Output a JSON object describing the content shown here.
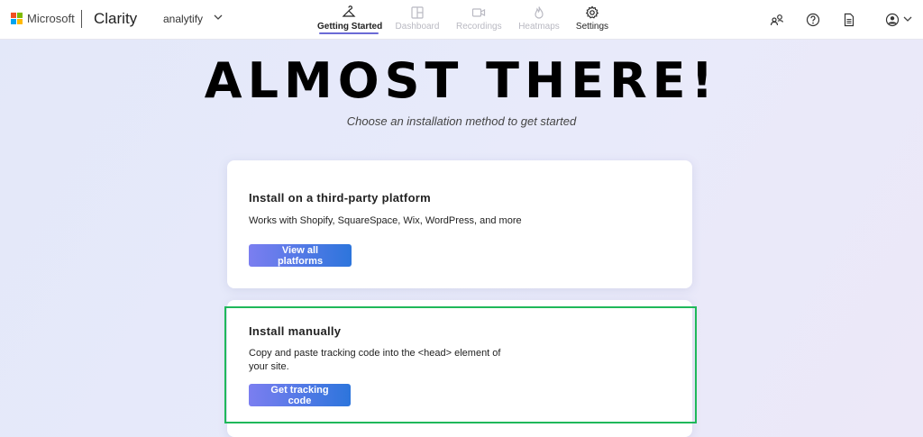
{
  "header": {
    "ms_text": "Microsoft",
    "brand": "Clarity",
    "project": "analytify",
    "logo_colors": [
      "#f25022",
      "#7fba00",
      "#00a4ef",
      "#ffb900"
    ]
  },
  "nav": {
    "getting_started": "Getting Started",
    "dashboard": "Dashboard",
    "recordings": "Recordings",
    "heatmaps": "Heatmaps",
    "settings": "Settings"
  },
  "icons": {
    "getting_started": "hanger-icon",
    "dashboard": "grid-icon",
    "recordings": "video-icon",
    "heatmaps": "flame-icon",
    "settings": "gear-icon",
    "account_switch": "people-icon",
    "help": "question-icon",
    "docs": "document-icon",
    "profile": "user-circle-icon"
  },
  "hero": {
    "headline": "ALMOST THERE!",
    "subtitle": "Choose an installation method to get started"
  },
  "cards": {
    "third_party": {
      "title": "Install on a third-party platform",
      "desc": "Works with Shopify, SquareSpace, Wix, WordPress, and more",
      "button": "View all platforms"
    },
    "manual": {
      "title": "Install manually",
      "desc": "Copy and paste tracking code into the <head> element of your site.",
      "button": "Get tracking code"
    }
  },
  "colors": {
    "accent": "#6a6ad6",
    "button_start": "#7b7ef0",
    "button_end": "#2d75dc",
    "highlight": "#1fb85a"
  }
}
